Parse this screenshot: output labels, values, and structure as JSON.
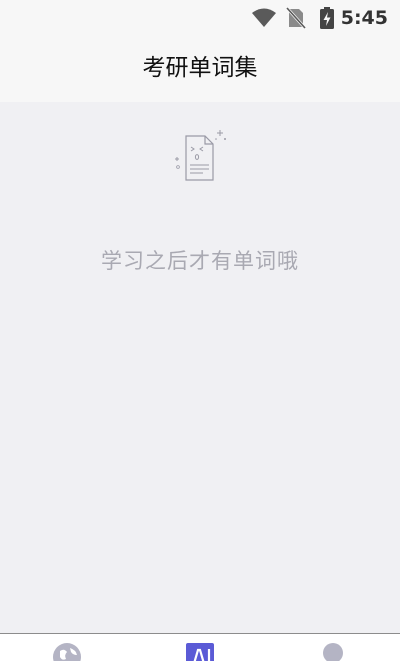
{
  "status_bar": {
    "time": "5:45",
    "icons": [
      "wifi-icon",
      "no-sim-icon",
      "battery-charging-icon"
    ]
  },
  "header": {
    "title": "考研单词集"
  },
  "empty_state": {
    "icon": "empty-document-icon",
    "message": "学习之后才有单词哦"
  },
  "tab_bar": {
    "tabs": [
      {
        "icon": "globe-icon",
        "active": false
      },
      {
        "icon": "word-book-icon",
        "active": true
      },
      {
        "icon": "profile-icon",
        "active": false
      }
    ],
    "active_color": "#5b5bd6",
    "inactive_color": "#b4b4c4"
  }
}
